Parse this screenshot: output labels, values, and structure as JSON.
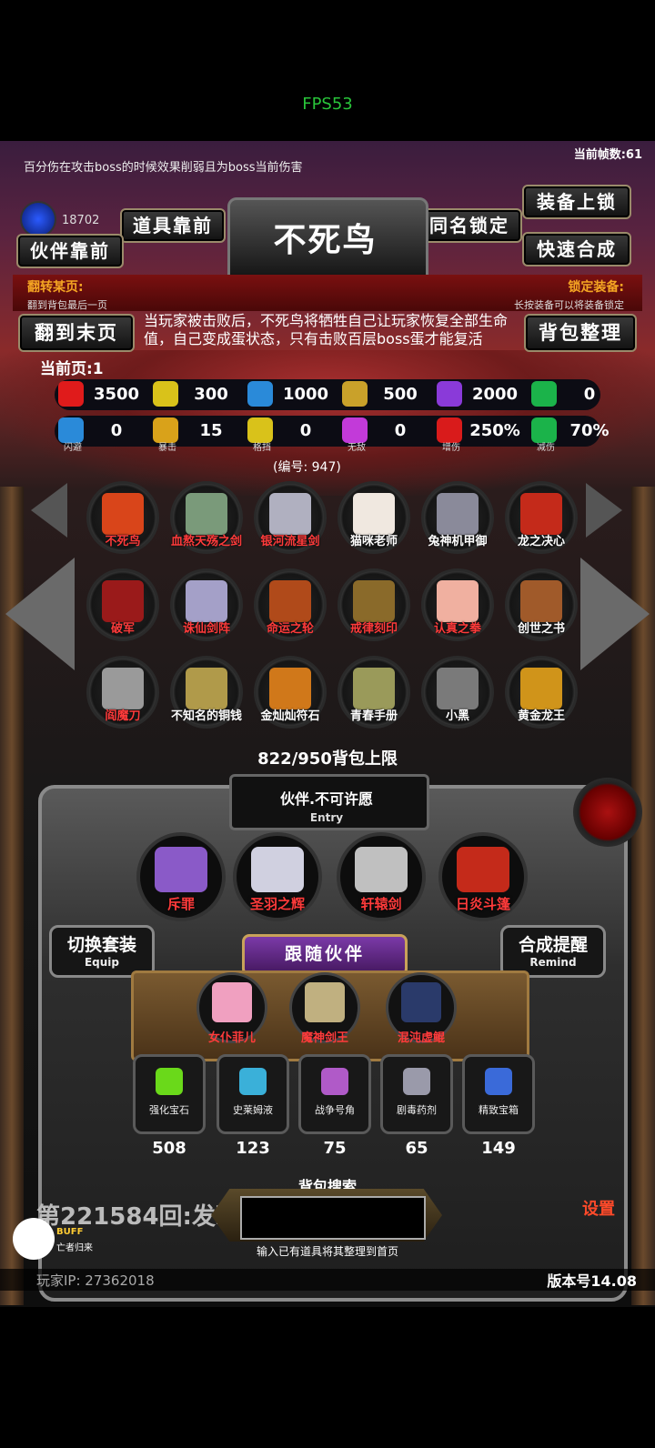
{
  "status": {
    "fps": "FPS53"
  },
  "header": {
    "tip": "百分伤在攻击boss的时候效果削弱且为boss当前伤害",
    "frame_count": "当前帧数:61",
    "currency": "18702",
    "title": "不死鸟"
  },
  "buttons": {
    "item_front": "道具靠前",
    "partner_front": "伙伴靠前",
    "same_name_lock": "同名锁定",
    "equip_lock": "装备上锁",
    "quick_compose": "快速合成",
    "flip_to_end": "翻到末页",
    "bag_sort": "背包整理"
  },
  "labels": {
    "flip_page": "翻转某页:",
    "flip_page_hint": "翻到背包最后一页",
    "lock_equip": "锁定装备:",
    "lock_equip_hint": "长按装备可以将装备锁定",
    "current_page": "当前页:1",
    "item_code": "(编号: 947)"
  },
  "description": "当玩家被击败后，不死鸟将牺牲自己让玩家恢复全部生命值，自己变成蛋状态，只有击败百层boss蛋才能复活",
  "stats_row1": [
    {
      "icon": "heart-icon",
      "value": "3500",
      "color": "#e01b1b"
    },
    {
      "icon": "strength-icon",
      "value": "300",
      "color": "#d9c21a"
    },
    {
      "icon": "helmet-icon",
      "value": "1000",
      "color": "#2a8ad9"
    },
    {
      "icon": "sword-icon",
      "value": "500",
      "color": "#c9a12a"
    },
    {
      "icon": "lightning-icon",
      "value": "2000",
      "color": "#8a3ad9"
    },
    {
      "icon": "clover-icon",
      "value": "0",
      "color": "#1bb34a"
    }
  ],
  "stats_row2": [
    {
      "icon": "dodge-icon",
      "value": "0",
      "name": "闪避",
      "color": "#2a8ad9"
    },
    {
      "icon": "crit-icon",
      "value": "15",
      "name": "暴击",
      "color": "#d9a21a"
    },
    {
      "icon": "block-icon",
      "value": "0",
      "name": "格挡",
      "color": "#d9c21a"
    },
    {
      "icon": "invincible-icon",
      "value": "0",
      "name": "无敌",
      "color": "#c23ad9"
    },
    {
      "icon": "damage-up-icon",
      "value": "250%",
      "name": "增伤",
      "color": "#d91b1b"
    },
    {
      "icon": "damage-down-icon",
      "value": "70%",
      "name": "减伤",
      "color": "#1bb34a"
    }
  ],
  "items": [
    {
      "name": "不死鸟",
      "color": "red",
      "art": "#d9451a"
    },
    {
      "name": "血熬天殇之剑",
      "color": "red",
      "art": "#7a9a7a"
    },
    {
      "name": "银河流星剑",
      "color": "red",
      "art": "#b0b0c0"
    },
    {
      "name": "猫咪老师",
      "color": "white",
      "art": "#f0e8e0"
    },
    {
      "name": "兔神机甲御",
      "color": "white",
      "art": "#8a8a9a"
    },
    {
      "name": "龙之决心",
      "color": "white",
      "art": "#c42a1a"
    },
    {
      "name": "破军",
      "color": "red",
      "art": "#9a1a1a"
    },
    {
      "name": "诛仙剑阵",
      "color": "red",
      "art": "#a4a0c8"
    },
    {
      "name": "命运之轮",
      "color": "red",
      "art": "#b04a1a"
    },
    {
      "name": "戒律刻印",
      "color": "red",
      "art": "#8a6a2a"
    },
    {
      "name": "认真之拳",
      "color": "red",
      "art": "#f0b0a0"
    },
    {
      "name": "创世之书",
      "color": "white",
      "art": "#a05a2a"
    },
    {
      "name": "阎魔刀",
      "color": "red",
      "art": "#9a9a9a"
    },
    {
      "name": "不知名的铜钱",
      "color": "white",
      "art": "#b09a4a"
    },
    {
      "name": "金灿灿符石",
      "color": "white",
      "art": "#d0781a"
    },
    {
      "name": "青春手册",
      "color": "white",
      "art": "#9a9a5a"
    },
    {
      "name": "小黑",
      "color": "white",
      "art": "#7a7a7a"
    },
    {
      "name": "黄金龙王",
      "color": "white",
      "art": "#d0941a"
    }
  ],
  "bag_capacity": "822/950背包上限",
  "entry": {
    "title": "伙伴.不可许愿",
    "subtitle": "Entry"
  },
  "equipped": [
    {
      "name": "斥罪",
      "art": "#8a5ac8"
    },
    {
      "name": "圣羽之辉",
      "art": "#d0d0e0"
    },
    {
      "name": "轩辕剑",
      "art": "#c0c0c0"
    },
    {
      "name": "日炎斗篷",
      "art": "#c42a1a"
    }
  ],
  "switch_set": {
    "label": "切换套装",
    "sub": "Equip"
  },
  "compose_remind": {
    "label": "合成提醒",
    "sub": "Remind"
  },
  "follow_partner": "跟随伙伴",
  "companions": [
    {
      "name": "女仆菲儿",
      "art": "#f0a0c0"
    },
    {
      "name": "魔神剑王",
      "art": "#c0b080"
    },
    {
      "name": "混沌虚鲲",
      "art": "#2a3a6a"
    }
  ],
  "inventory": [
    {
      "name": "强化宝石",
      "count": "508",
      "art": "#6ad91a"
    },
    {
      "name": "史莱姆液",
      "count": "123",
      "art": "#3ab0d9"
    },
    {
      "name": "战争号角",
      "count": "75",
      "art": "#b05ac8"
    },
    {
      "name": "剧毒药剂",
      "count": "65",
      "art": "#9a9aaa"
    },
    {
      "name": "精致宝箱",
      "count": "149",
      "art": "#3a6ad9"
    }
  ],
  "search": {
    "label": "背包搜索",
    "hint": "输入已有道具将其整理到首页"
  },
  "log_line": "第221584回:发现",
  "buff": {
    "label": "BUFF",
    "name": "亡者归来"
  },
  "footer": {
    "player_ip": "玩家IP: 27362018",
    "version": "版本号14.08",
    "settings": "设置"
  }
}
